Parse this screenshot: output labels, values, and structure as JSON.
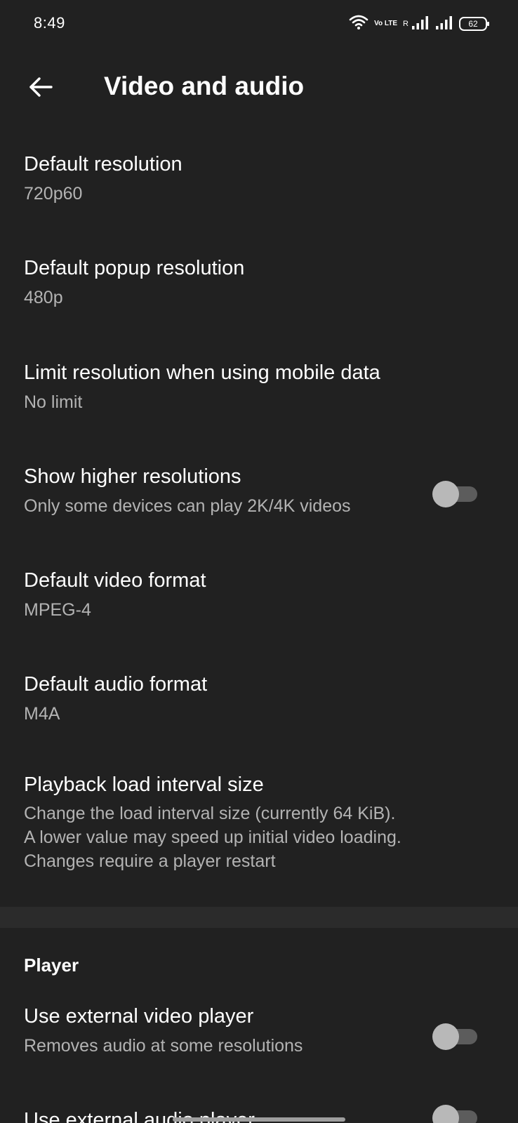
{
  "status_bar": {
    "time": "8:49",
    "network_label": "Vo LTE",
    "roaming_label": "R",
    "battery": "62"
  },
  "toolbar": {
    "title": "Video and audio",
    "back_icon": "arrow-back-icon"
  },
  "items": [
    {
      "title": "Default resolution",
      "summary": "720p60"
    },
    {
      "title": "Default popup resolution",
      "summary": "480p"
    },
    {
      "title": "Limit resolution when using mobile data",
      "summary": "No limit"
    },
    {
      "title": "Show higher resolutions",
      "summary": "Only some devices can play 2K/4K videos",
      "toggle": false
    },
    {
      "title": "Default video format",
      "summary": "MPEG-4"
    },
    {
      "title": "Default audio format",
      "summary": "M4A"
    },
    {
      "title": "Playback load interval size",
      "summary_lines": [
        "Change the load interval size (currently 64 KiB).",
        "A lower value may speed up initial video loading.",
        "Changes require a player restart"
      ]
    }
  ],
  "player_section": {
    "header": "Player",
    "items": [
      {
        "title": "Use external video player",
        "summary": "Removes audio at some resolutions",
        "toggle": false
      },
      {
        "title": "Use external audio player",
        "toggle": false
      }
    ]
  },
  "colors": {
    "background": "#212121",
    "text_primary": "#ffffff",
    "text_secondary": "#b3b3b3",
    "toggle_thumb_off": "#b8b8b8",
    "toggle_track_off": "#5c5c5c"
  }
}
